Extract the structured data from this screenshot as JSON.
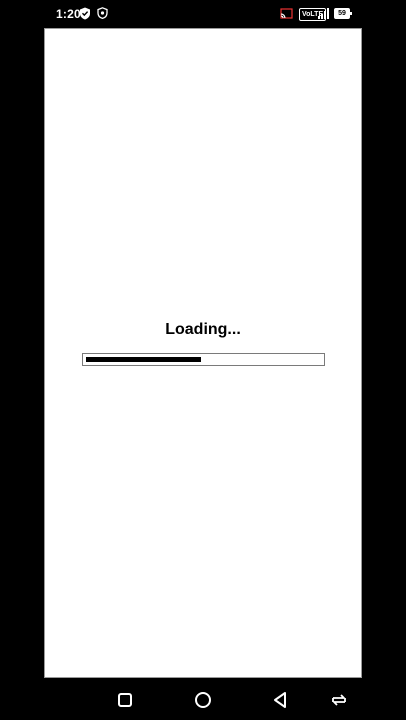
{
  "status_bar": {
    "time": "1:20",
    "icons": [
      "shield-check-icon",
      "shield-outline-icon",
      "cast-icon",
      "volte-badge",
      "signal-icon",
      "battery-icon"
    ],
    "volte_label": "VoLTE",
    "battery_level": "59"
  },
  "app": {
    "loading_text": "Loading...",
    "progress_fraction": 0.49
  },
  "nav_bar": {
    "buttons": [
      "recents-icon",
      "home-icon",
      "back-icon",
      "rotate-icon"
    ]
  },
  "colors": {
    "background": "#000000",
    "viewport": "#ffffff",
    "progress_fill": "#000000",
    "progress_border": "#7a7a7a"
  }
}
